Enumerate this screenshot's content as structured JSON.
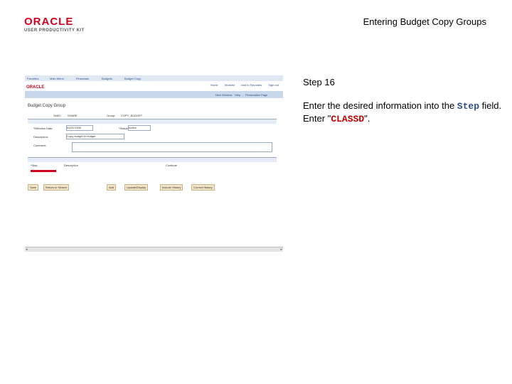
{
  "logo": {
    "brand": "ORACLE",
    "subtitle": "USER PRODUCTIVITY KIT"
  },
  "slide_title": "Entering Budget Copy Groups",
  "screenshot": {
    "nav_items": [
      "Favorites",
      "Main Menu",
      "Financials",
      "Budgets",
      "Budget Copy"
    ],
    "brand": "ORACLE",
    "top_links": [
      "Home",
      "Worklist",
      "Add to Favorites",
      "Sign out"
    ],
    "band_links": [
      "New Window",
      "Help",
      "Personalize Page"
    ],
    "page_title": "Budget Copy Group",
    "setid_label": "SetID:",
    "setid_value": "SHARE",
    "group_label": "Group:",
    "group_value": "COPY_BUDGET",
    "effective_date_label": "*Effective Date:",
    "effective_date_value": "01/01/1900",
    "status_label": "*Status:",
    "status_value": "Active",
    "description_label": "Description:",
    "description_value": "Copy budget to budget",
    "comment_label": "Comment:",
    "steps_col": "*Step",
    "description_col": "Description",
    "continue_col": "Continue",
    "buttons": [
      "Save",
      "Return to Search",
      "Add",
      "Update/Display",
      "Include History",
      "Correct History"
    ]
  },
  "instruction": {
    "step": "Step 16",
    "text_before": "Enter the desired information into the ",
    "field": "Step",
    "text_middle": " field. Enter \"",
    "value": "CLASSD",
    "text_after": "\"."
  }
}
